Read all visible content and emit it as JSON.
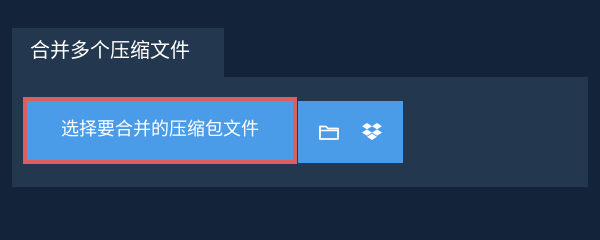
{
  "tab": {
    "title": "合并多个压缩文件"
  },
  "upload": {
    "select_label": "选择要合并的压缩包文件",
    "folder_icon": "folder-icon",
    "dropbox_icon": "dropbox-icon"
  },
  "colors": {
    "background": "#13233a",
    "panel": "#23384f",
    "button": "#4a9be8",
    "focus_border": "#d9605e",
    "text": "#ffffff"
  }
}
